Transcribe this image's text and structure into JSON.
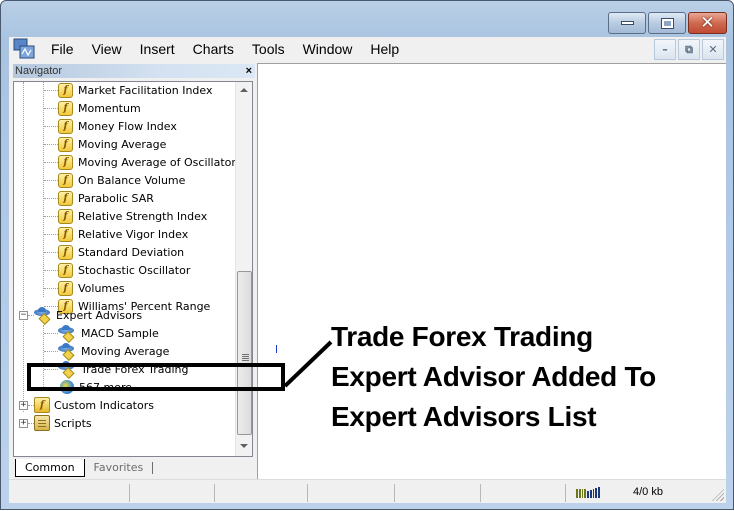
{
  "window": {
    "caption_buttons": [
      "minimize",
      "maximize",
      "close"
    ]
  },
  "menubar": {
    "items": [
      "File",
      "View",
      "Insert",
      "Charts",
      "Tools",
      "Window",
      "Help"
    ],
    "mdi_buttons": [
      "–",
      "⧉",
      "✕"
    ]
  },
  "navigator": {
    "title": "Navigator",
    "close_glyph": "×",
    "indicators": [
      "Market Facilitation Index",
      "Momentum",
      "Money Flow Index",
      "Moving Average",
      "Moving Average of Oscillator",
      "On Balance Volume",
      "Parabolic SAR",
      "Relative Strength Index",
      "Relative Vigor Index",
      "Standard Deviation",
      "Stochastic Oscillator",
      "Volumes",
      "Williams' Percent Range"
    ],
    "expert_advisors": {
      "label": "Expert Advisors",
      "expander": "−",
      "items": [
        "MACD Sample",
        "Moving Average",
        "Trade Forex Trading"
      ],
      "more": "567 more..."
    },
    "custom_indicators": {
      "label": "Custom Indicators",
      "expander": "+"
    },
    "scripts": {
      "label": "Scripts",
      "expander": "+"
    },
    "tabs": [
      {
        "label": "Common",
        "active": true
      },
      {
        "label": "Favorites",
        "active": false
      }
    ]
  },
  "statusbar": {
    "traffic": "4/0 kb"
  },
  "annotation": {
    "lines": [
      "Trade Forex Trading",
      "Expert Advisor Added To",
      "Expert Advisors List"
    ]
  }
}
